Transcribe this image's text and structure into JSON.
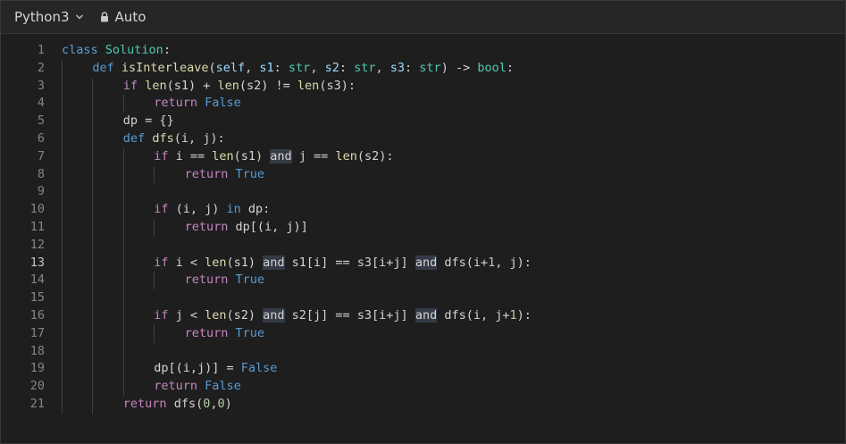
{
  "toolbar": {
    "language": "Python3",
    "language_icon": "chevron-down-icon",
    "mode_icon": "lock-icon",
    "mode": "Auto"
  },
  "editor": {
    "active_line": 13,
    "lines": [
      {
        "n": "1",
        "indent": 0,
        "tokens": [
          [
            "kw",
            "class"
          ],
          [
            "op",
            " "
          ],
          [
            "cls",
            "Solution"
          ],
          [
            "op",
            ":"
          ]
        ]
      },
      {
        "n": "2",
        "indent": 1,
        "tokens": [
          [
            "kw",
            "def"
          ],
          [
            "op",
            " "
          ],
          [
            "fn",
            "isInterleave"
          ],
          [
            "op",
            "("
          ],
          [
            "prm",
            "self"
          ],
          [
            "op",
            ", "
          ],
          [
            "prm",
            "s1"
          ],
          [
            "op",
            ": "
          ],
          [
            "cls",
            "str"
          ],
          [
            "op",
            ", "
          ],
          [
            "prm",
            "s2"
          ],
          [
            "op",
            ": "
          ],
          [
            "cls",
            "str"
          ],
          [
            "op",
            ", "
          ],
          [
            "prm",
            "s3"
          ],
          [
            "op",
            ": "
          ],
          [
            "cls",
            "str"
          ],
          [
            "op",
            ") -> "
          ],
          [
            "cls",
            "bool"
          ],
          [
            "op",
            ":"
          ]
        ]
      },
      {
        "n": "3",
        "indent": 2,
        "tokens": [
          [
            "ctl",
            "if"
          ],
          [
            "op",
            " "
          ],
          [
            "fn",
            "len"
          ],
          [
            "op",
            "(s1) + "
          ],
          [
            "fn",
            "len"
          ],
          [
            "op",
            "(s2) != "
          ],
          [
            "fn",
            "len"
          ],
          [
            "op",
            "(s3):"
          ]
        ]
      },
      {
        "n": "4",
        "indent": 3,
        "tokens": [
          [
            "ctl",
            "return"
          ],
          [
            "op",
            " "
          ],
          [
            "kw",
            "False"
          ]
        ]
      },
      {
        "n": "5",
        "indent": 2,
        "tokens": [
          [
            "op",
            "dp = {}"
          ]
        ]
      },
      {
        "n": "6",
        "indent": 2,
        "tokens": [
          [
            "kw",
            "def"
          ],
          [
            "op",
            " "
          ],
          [
            "fn",
            "dfs"
          ],
          [
            "op",
            "(i, j):"
          ]
        ]
      },
      {
        "n": "7",
        "indent": 3,
        "tokens": [
          [
            "ctl",
            "if"
          ],
          [
            "op",
            " i == "
          ],
          [
            "fn",
            "len"
          ],
          [
            "op",
            "(s1) "
          ],
          [
            "hl",
            "and"
          ],
          [
            "op",
            " j == "
          ],
          [
            "fn",
            "len"
          ],
          [
            "op",
            "(s2):"
          ]
        ]
      },
      {
        "n": "8",
        "indent": 4,
        "tokens": [
          [
            "ctl",
            "return"
          ],
          [
            "op",
            " "
          ],
          [
            "kw",
            "True"
          ]
        ]
      },
      {
        "n": "9",
        "indent": 3,
        "tokens": []
      },
      {
        "n": "10",
        "indent": 3,
        "tokens": [
          [
            "ctl",
            "if"
          ],
          [
            "op",
            " (i, j) "
          ],
          [
            "kw",
            "in"
          ],
          [
            "op",
            " dp:"
          ]
        ]
      },
      {
        "n": "11",
        "indent": 4,
        "tokens": [
          [
            "ctl",
            "return"
          ],
          [
            "op",
            " dp[(i, j)]"
          ]
        ]
      },
      {
        "n": "12",
        "indent": 3,
        "tokens": []
      },
      {
        "n": "13",
        "indent": 3,
        "tokens": [
          [
            "ctl",
            "if"
          ],
          [
            "op",
            " i < "
          ],
          [
            "fn",
            "len"
          ],
          [
            "op",
            "(s1) "
          ],
          [
            "hl",
            "and"
          ],
          [
            "op",
            " s1[i] == s3[i+j] "
          ],
          [
            "hl",
            "and"
          ],
          [
            "op",
            " dfs(i+"
          ],
          [
            "num",
            "1"
          ],
          [
            "op",
            ", j):"
          ]
        ]
      },
      {
        "n": "14",
        "indent": 4,
        "tokens": [
          [
            "ctl",
            "return"
          ],
          [
            "op",
            " "
          ],
          [
            "kw",
            "True"
          ]
        ]
      },
      {
        "n": "15",
        "indent": 3,
        "tokens": []
      },
      {
        "n": "16",
        "indent": 3,
        "tokens": [
          [
            "ctl",
            "if"
          ],
          [
            "op",
            " j < "
          ],
          [
            "fn",
            "len"
          ],
          [
            "op",
            "(s2) "
          ],
          [
            "hl",
            "and"
          ],
          [
            "op",
            " s2[j] == s3[i+j] "
          ],
          [
            "hl",
            "and"
          ],
          [
            "op",
            " dfs(i, j+"
          ],
          [
            "num",
            "1"
          ],
          [
            "op",
            "):"
          ]
        ]
      },
      {
        "n": "17",
        "indent": 4,
        "tokens": [
          [
            "ctl",
            "return"
          ],
          [
            "op",
            " "
          ],
          [
            "kw",
            "True"
          ]
        ]
      },
      {
        "n": "18",
        "indent": 3,
        "tokens": []
      },
      {
        "n": "19",
        "indent": 3,
        "tokens": [
          [
            "op",
            "dp[(i,j)] = "
          ],
          [
            "kw",
            "False"
          ]
        ]
      },
      {
        "n": "20",
        "indent": 3,
        "tokens": [
          [
            "ctl",
            "return"
          ],
          [
            "op",
            " "
          ],
          [
            "kw",
            "False"
          ]
        ]
      },
      {
        "n": "21",
        "indent": 2,
        "tokens": [
          [
            "ctl",
            "return"
          ],
          [
            "op",
            " dfs("
          ],
          [
            "num",
            "0"
          ],
          [
            "op",
            ","
          ],
          [
            "num",
            "0"
          ],
          [
            "op",
            ")"
          ]
        ]
      }
    ]
  }
}
